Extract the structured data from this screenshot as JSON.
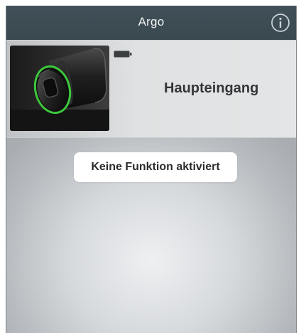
{
  "navbar": {
    "title": "Argo",
    "info_icon": "info-icon"
  },
  "device": {
    "name": "Haupteingang",
    "image_icon": "door-lock-cylinder-image",
    "battery_icon": "battery-icon",
    "accent_color": "#3cc83c"
  },
  "toast": {
    "message": "Keine Funktion aktiviert"
  },
  "colors": {
    "navbar_bg": "#3d4b53",
    "toast_bg": "#ffffff"
  }
}
